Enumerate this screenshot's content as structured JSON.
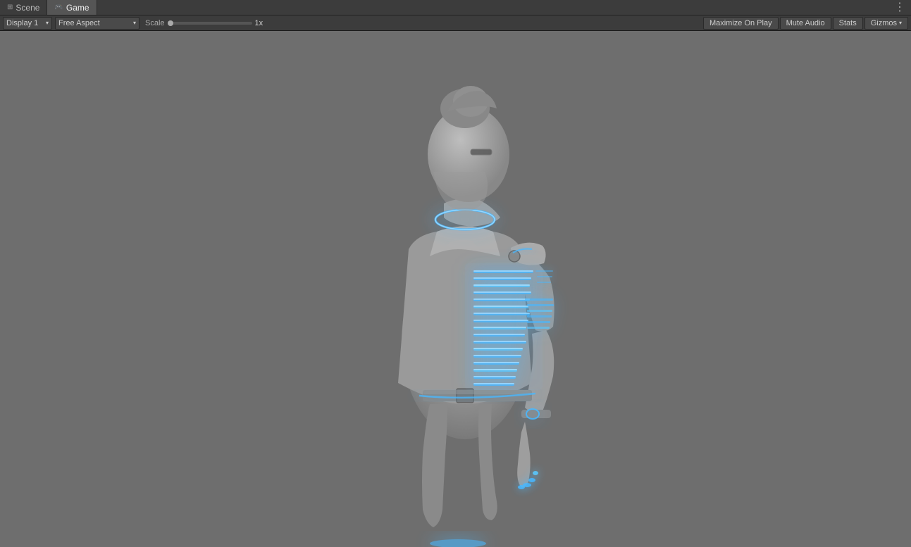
{
  "tabs": [
    {
      "id": "scene",
      "label": "Scene",
      "icon": "⊞",
      "active": false
    },
    {
      "id": "game",
      "label": "Game",
      "icon": "🎮",
      "active": true
    }
  ],
  "more_button": "⋮",
  "toolbar": {
    "display_label": "Display 1",
    "aspect_label": "Free Aspect",
    "scale_label": "Scale",
    "scale_value": "1x",
    "buttons": [
      {
        "id": "maximize",
        "label": "Maximize On Play"
      },
      {
        "id": "mute",
        "label": "Mute Audio"
      },
      {
        "id": "stats",
        "label": "Stats"
      },
      {
        "id": "gizmos",
        "label": "Gizmos",
        "has_arrow": true
      }
    ]
  },
  "viewport": {
    "background_color": "#6e6e6e"
  }
}
